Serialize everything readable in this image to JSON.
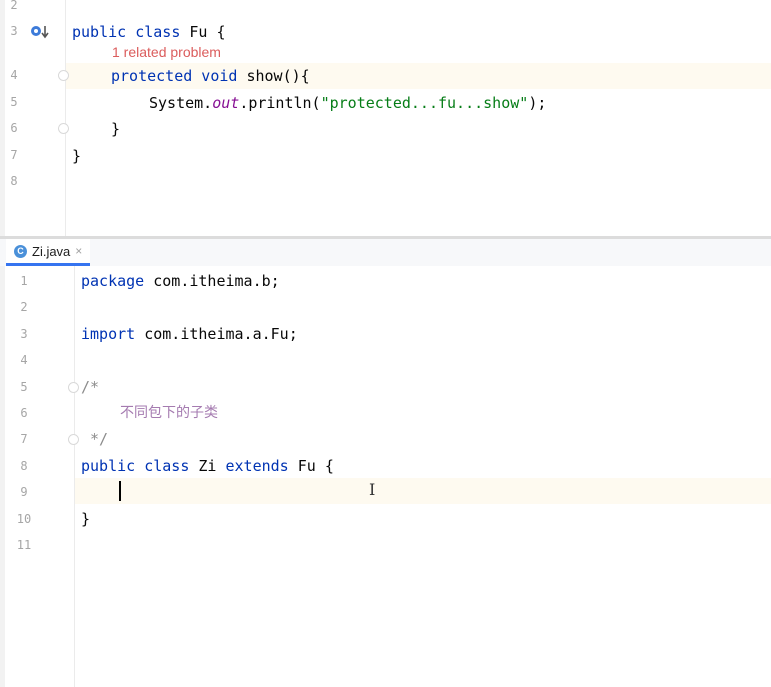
{
  "top_editor": {
    "line_numbers": [
      "2",
      "3",
      "4",
      "5",
      "6",
      "7",
      "8"
    ],
    "related_problem": "1 related problem",
    "code": {
      "l3_kw": "public class ",
      "l3_rest": "Fu {",
      "l4_kw": "protected void ",
      "l4_rest": "show(){",
      "l5_a": "System.",
      "l5_b": "out",
      "l5_c": ".println(",
      "l5_str": "\"protected...fu...show\"",
      "l5_d": ");",
      "l6": "}",
      "l7": "}"
    }
  },
  "tab": {
    "icon_letter": "C",
    "label": "Zi.java",
    "close": "×"
  },
  "bottom_editor": {
    "line_numbers": [
      "1",
      "2",
      "3",
      "4",
      "5",
      "6",
      "7",
      "8",
      "9",
      "10",
      "11"
    ],
    "code": {
      "l1_kw": "package ",
      "l1_rest": "com.itheima.b;",
      "l3_kw": "import ",
      "l3_rest": "com.itheima.a.Fu;",
      "l5": "/*",
      "l6": "不同包下的子类",
      "l7": " */",
      "l8_kw1": "public class ",
      "l8_a": "Zi ",
      "l8_kw2": "extends ",
      "l8_b": "Fu {",
      "l10": "}"
    }
  },
  "colors": {
    "keyword": "#0033b3",
    "string": "#067d17",
    "static_field": "#871094",
    "comment": "#8c8c8c",
    "problem": "#db5c5c",
    "current_line": "#fefaf0"
  },
  "icons": [
    "implemented-method-icon",
    "java-class-icon",
    "fold-marker-icon",
    "text-cursor-icon"
  ]
}
